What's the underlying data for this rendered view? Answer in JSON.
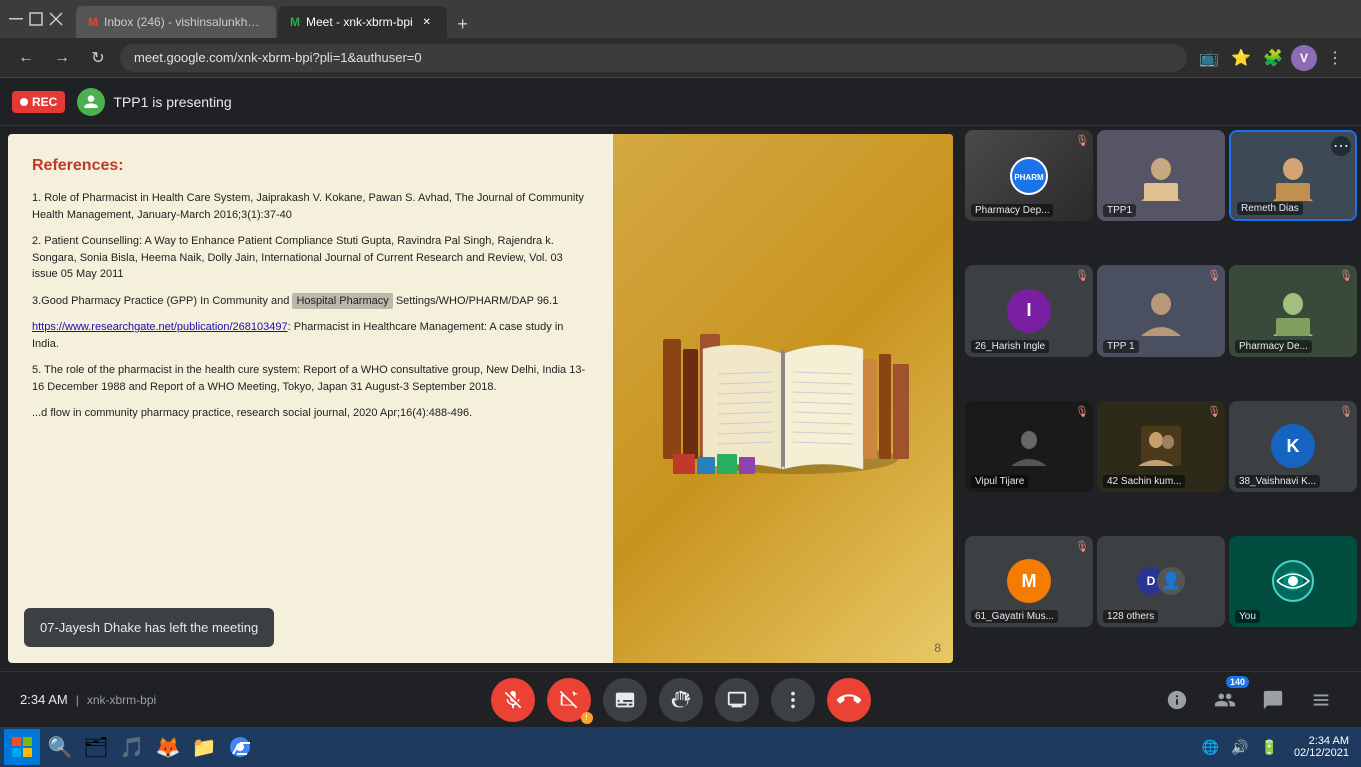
{
  "browser": {
    "tabs": [
      {
        "id": "gmail",
        "favicon_color": "#ea4335",
        "label": "Inbox (246) - vishinsalunkhe@g...",
        "active": false,
        "closeable": false
      },
      {
        "id": "meet",
        "favicon_color": "#34a853",
        "label": "Meet - xnk-xbrm-bpi",
        "active": true,
        "closeable": true
      }
    ],
    "new_tab_label": "+",
    "address": "meet.google.com/xnk-xbrm-bpi?pli=1&authuser=0",
    "profile_initial": "V"
  },
  "meet_header": {
    "rec_label": "REC",
    "presenter_label": "TPP1 is presenting"
  },
  "slide": {
    "title": "References:",
    "refs": [
      "1. Role of Pharmacist in Health Care System, Jaiprakash V. Kokane, Pawan S. Avhad, The Journal of Community Health Management, January-March 2016;3(1):37-40",
      "2. Patient Counselling: A Way to Enhance Patient Compliance Stuti Gupta, Ravindra Pal Singh, Rajendra k. Songara, Sonia Bisla, Heema Naik, Dolly Jain, International Journal of Current Research and Review, Vol. 03 issue 05 May 2011",
      "3.Good Pharmacy Practice (GPP) In Community and Hospital Pharmacy Settings/WHO/PHARM/DAP 96.1",
      "4. https://www.researchgate.net/publication/268103497: Pharmacist in Healthcare Management: A case study in India.",
      "5. The role of the pharmacist in the health cure system: Report of a WHO consultative group, New Delhi, India 13-16 December 1988 and Report of a WHO Meeting, Tokyo, Japan 31 August-3 September 2018."
    ],
    "ref5_partial": "...d flow in community pharmacy practice, research social journal, 2020 Apr;16(4):488-496.",
    "slide_number": "8",
    "hospital_pharmacy_text": "Hospital Pharmacy"
  },
  "notification": {
    "message": "07-Jayesh Dhake has left the meeting"
  },
  "participants": [
    {
      "id": "pharmacy-dep",
      "name": "Pharmacy Dep...",
      "avatar_letter": "",
      "avatar_color": "",
      "muted": true,
      "has_video": true,
      "video_type": "logo_blue"
    },
    {
      "id": "tpp1",
      "name": "TPP1",
      "avatar_letter": "",
      "avatar_color": "",
      "muted": false,
      "has_video": true,
      "video_type": "person_female"
    },
    {
      "id": "remeth-dias",
      "name": "Remeth Dias",
      "avatar_letter": "",
      "avatar_color": "",
      "muted": false,
      "has_video": true,
      "video_type": "person_male",
      "active_border": true,
      "has_options": true
    },
    {
      "id": "26-harish-ingle",
      "name": "26_Harish Ingle",
      "avatar_letter": "I",
      "avatar_color": "avatar-purple",
      "muted": true,
      "has_video": false
    },
    {
      "id": "tpp1-2",
      "name": "TPP 1",
      "avatar_letter": "",
      "avatar_color": "",
      "muted": true,
      "has_video": true,
      "video_type": "person_female2"
    },
    {
      "id": "pharmacy-de2",
      "name": "Pharmacy De...",
      "avatar_letter": "",
      "avatar_color": "",
      "muted": true,
      "has_video": true,
      "video_type": "person_male2"
    },
    {
      "id": "vipul-tijare",
      "name": "Vipul Tijare",
      "avatar_letter": "",
      "avatar_color": "",
      "muted": true,
      "has_video": true,
      "video_type": "person_bw"
    },
    {
      "id": "42-sachin-kum",
      "name": "42 Sachin kum...",
      "avatar_letter": "",
      "avatar_color": "",
      "muted": true,
      "has_video": true,
      "video_type": "person_group"
    },
    {
      "id": "38-vaishnavi-k",
      "name": "38_Vaishnavi K...",
      "avatar_letter": "K",
      "avatar_color": "avatar-blue",
      "muted": true,
      "has_video": false
    },
    {
      "id": "61-gayatri-mus",
      "name": "61_Gayatri Mus...",
      "avatar_letter": "M",
      "avatar_color": "avatar-orange",
      "muted": true,
      "has_video": false
    },
    {
      "id": "128-others",
      "name": "128 others",
      "avatar_letter": "D",
      "avatar_color": "avatar-indigo",
      "muted": false,
      "has_video": true,
      "video_type": "group_icon"
    },
    {
      "id": "you",
      "name": "You",
      "avatar_letter": "",
      "avatar_color": "avatar-cyan",
      "muted": false,
      "has_video": true,
      "video_type": "you_icon"
    }
  ],
  "controls": {
    "time": "2:34 AM",
    "meeting_id": "xnk-xbrm-bpi",
    "separator": "|",
    "mic_muted": true,
    "cam_muted": true,
    "participant_count": "140",
    "buttons": {
      "mic": "🎤",
      "cam": "📹",
      "captions": "CC",
      "raise_hand": "✋",
      "present": "⬆",
      "more": "⋮",
      "end_call": "📞",
      "info": "ℹ",
      "participants": "👥",
      "chat": "💬",
      "activities": "🎯"
    }
  },
  "taskbar": {
    "time": "2:34 AM",
    "date": "02/12/2021",
    "icons": [
      "🪟",
      "🎵",
      "🦊",
      "📁",
      "🌐"
    ]
  }
}
